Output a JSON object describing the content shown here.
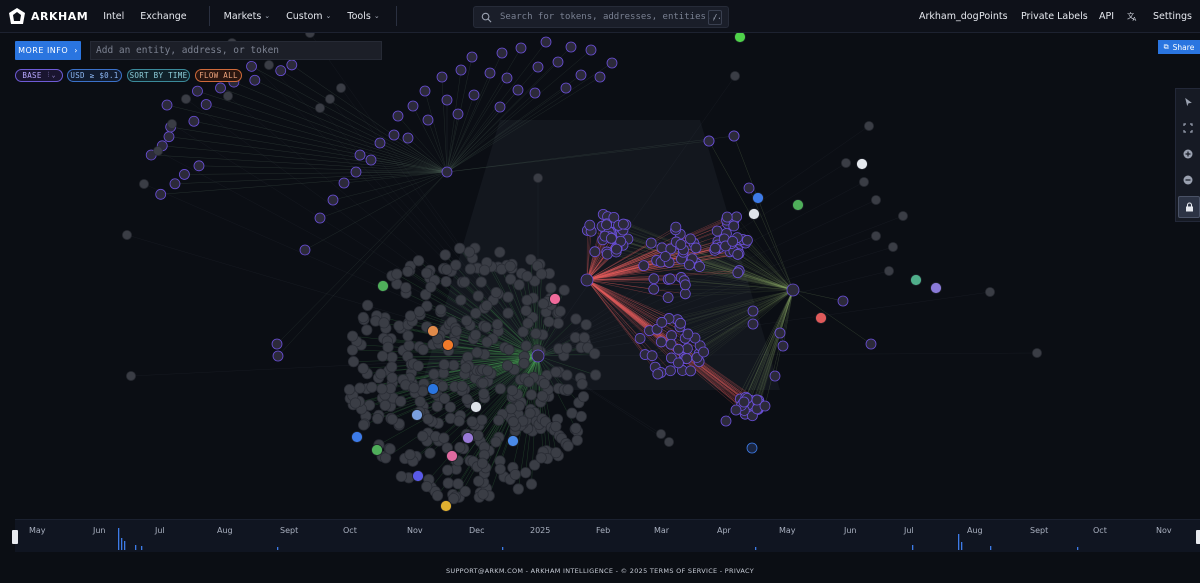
{
  "brand": {
    "name": "ARKHAM"
  },
  "nav": {
    "intel": "Intel",
    "exchange": "Exchange",
    "markets": "Markets",
    "custom": "Custom",
    "tools": "Tools"
  },
  "search": {
    "placeholder": "Search for tokens, addresses, entities...",
    "shortcut": "/"
  },
  "right_nav": {
    "user": "Arkham_dog",
    "points": "Points",
    "private_labels": "Private Labels",
    "api": "API",
    "settings": "Settings"
  },
  "controls": {
    "more_info": "MORE INFO",
    "entity_placeholder": "Add an entity, address, or token",
    "chip_base": "BASE",
    "chip_usd": "USD ≥ $0.1",
    "chip_sort": "SORT BY TIME",
    "chip_flow": "FLOW ALL",
    "share": "Share"
  },
  "toolbar": {
    "icons": [
      "cursor-icon",
      "fit-screen-icon",
      "zoom-in-icon",
      "zoom-out-icon",
      "lock-icon"
    ]
  },
  "timeline": {
    "months": [
      "May",
      "Jun",
      "Jul",
      "Aug",
      "Sept",
      "Oct",
      "Nov",
      "Dec",
      "2025",
      "Feb",
      "Mar",
      "Apr",
      "May",
      "Jun",
      "Jul",
      "Aug",
      "Sept",
      "Oct",
      "Nov"
    ]
  },
  "footer": {
    "text": "SUPPORT@ARKM.COM - ARKHAM INTELLIGENCE - © 2025  TERMS OF SERVICE - PRIVACY"
  },
  "colors": {
    "accent": "#2a75e0",
    "background": "#0b0e14",
    "flow_green": "#4fae5a",
    "flow_red": "#e05a5a",
    "node_ring": "#6a4fd8"
  }
}
